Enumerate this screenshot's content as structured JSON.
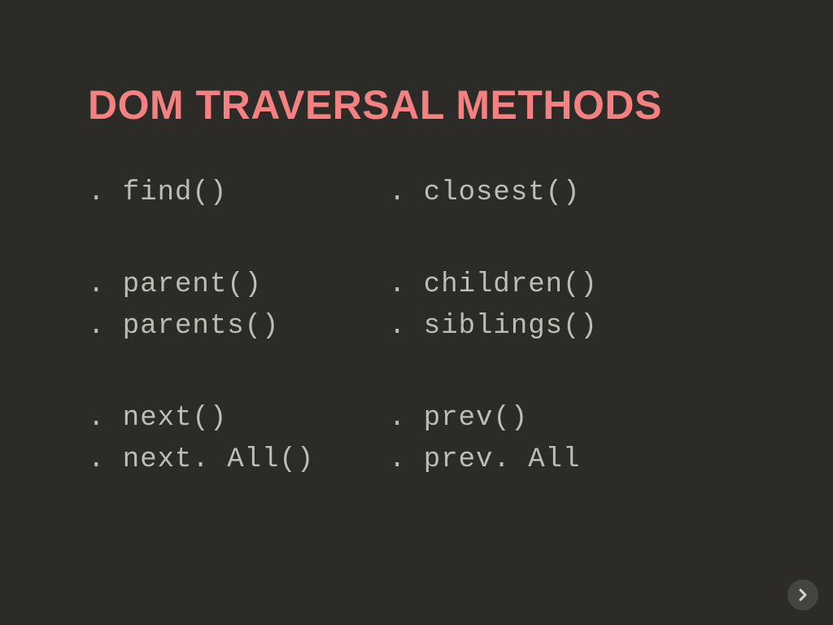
{
  "title": "DOM TRAVERSAL METHODS",
  "grid": {
    "r0c0": ". find()",
    "r0c1": ". closest()",
    "r1c0": ". parent()\n. parents()",
    "r1c1": ". children()\n. siblings()",
    "r2c0": ". next()\n. next. All()",
    "r2c1": ". prev()\n. prev. All"
  },
  "nav": {
    "next_icon": "arrow-right-circle"
  }
}
